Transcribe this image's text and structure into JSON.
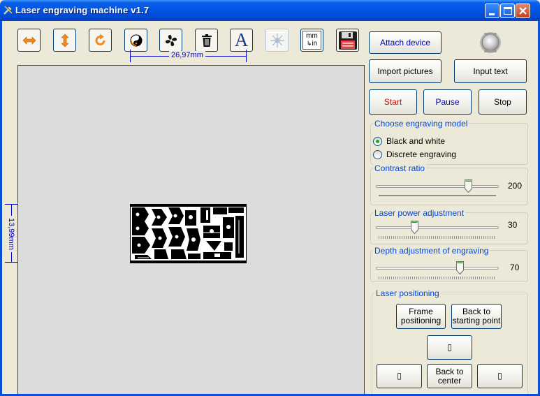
{
  "window": {
    "title": "Laser engraving machine v1.7",
    "icon": "tools-icon"
  },
  "toolbar": {
    "tools": [
      {
        "name": "flip-horizontal",
        "icon": "horizontal-arrows-icon"
      },
      {
        "name": "flip-vertical",
        "icon": "vertical-arrows-icon"
      },
      {
        "name": "rotate",
        "icon": "rotate-clockwise-icon"
      },
      {
        "name": "invert",
        "icon": "yin-yang-icon"
      },
      {
        "name": "fan",
        "icon": "fan-icon"
      },
      {
        "name": "delete",
        "icon": "trash-icon"
      },
      {
        "name": "text",
        "icon": "letter-a-icon",
        "glyph": "A"
      },
      {
        "name": "crosshair",
        "icon": "crosshair-icon",
        "disabled": true
      },
      {
        "name": "units",
        "icon": "mm-in-icon",
        "line1": "mm",
        "line2": "in"
      },
      {
        "name": "save",
        "icon": "floppy-disk-icon"
      }
    ]
  },
  "canvas": {
    "width_label": "26,97mm",
    "height_label": "13,99mm"
  },
  "device": {
    "attach_label": "Attach device",
    "status_icon": "connection-light-icon"
  },
  "actions": {
    "import_label": "Import pictures",
    "input_text_label": "Input text",
    "start_label": "Start",
    "pause_label": "Pause",
    "stop_label": "Stop"
  },
  "engraving_model": {
    "title": "Choose engraving model",
    "options": [
      {
        "label": "Black and white",
        "checked": true
      },
      {
        "label": "Discrete engraving",
        "checked": false
      }
    ]
  },
  "sliders": {
    "contrast": {
      "title": "Contrast ratio",
      "value": "200",
      "fraction": 0.77
    },
    "power": {
      "title": "Laser power adjustment",
      "value": "30",
      "fraction": 0.3
    },
    "depth": {
      "title": "Depth adjustment of engraving",
      "value": "70",
      "fraction": 0.7
    }
  },
  "positioning": {
    "title": "Laser positioning",
    "frame_label": "Frame\npositioning",
    "back_start_label": "Back to\nstarting point",
    "up_label": "▯",
    "left_label": "▯",
    "center_label": "Back to\ncenter",
    "right_label": "▯"
  },
  "colors": {
    "accent": "#0046D5",
    "dimension": "#0000C8",
    "start_text": "#E00000",
    "titlebar": "#0055E5"
  }
}
